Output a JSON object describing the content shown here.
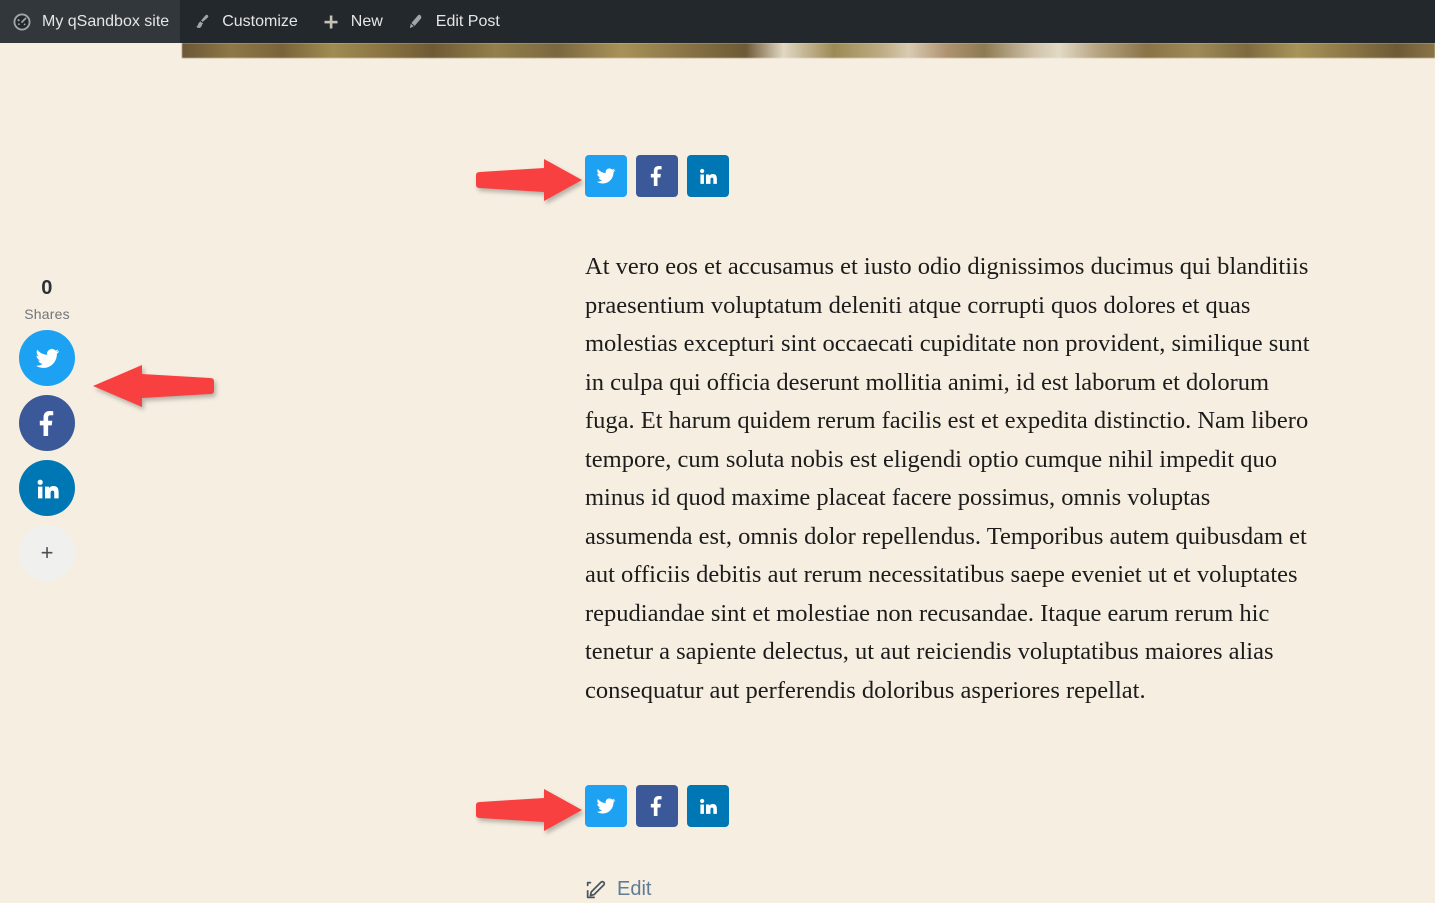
{
  "admin_bar": {
    "items": [
      {
        "icon": "wordpress-dashboard-icon",
        "label": "My qSandbox site"
      },
      {
        "icon": "paintbrush-icon",
        "label": "Customize"
      },
      {
        "icon": "plus-icon",
        "label": "New"
      },
      {
        "icon": "pencil-icon",
        "label": "Edit Post"
      }
    ],
    "background_color": "#23282d",
    "text_color": "#e5e5e5"
  },
  "page": {
    "background_color": "#f5eee1"
  },
  "float_share": {
    "count": "0",
    "count_label": "Shares",
    "buttons": [
      {
        "network": "twitter",
        "icon": "twitter-icon",
        "color": "#1da1f2"
      },
      {
        "network": "facebook",
        "icon": "facebook-icon",
        "color": "#3b5998"
      },
      {
        "network": "linkedin",
        "icon": "linkedin-icon",
        "color": "#0077b5"
      },
      {
        "network": "more",
        "icon": "plus-icon",
        "color": "#f0f0ee",
        "glyph": "+"
      }
    ]
  },
  "share_row_top": {
    "buttons": [
      {
        "network": "twitter",
        "icon": "twitter-icon",
        "color": "#1da1f2"
      },
      {
        "network": "facebook",
        "icon": "facebook-icon",
        "color": "#3b5998"
      },
      {
        "network": "linkedin",
        "icon": "linkedin-icon",
        "color": "#0077b5"
      }
    ]
  },
  "share_row_bottom": {
    "buttons": [
      {
        "network": "twitter",
        "icon": "twitter-icon",
        "color": "#1da1f2"
      },
      {
        "network": "facebook",
        "icon": "facebook-icon",
        "color": "#3b5998"
      },
      {
        "network": "linkedin",
        "icon": "linkedin-icon",
        "color": "#0077b5"
      }
    ]
  },
  "post": {
    "body": "At vero eos et accusamus et iusto odio dignissimos ducimus qui blanditiis praesentium voluptatum deleniti atque corrupti quos dolores et quas molestias excepturi sint occaecati cupiditate non provident, similique sunt in culpa qui officia deserunt mollitia animi, id est laborum et dolorum fuga. Et harum quidem rerum facilis est et expedita distinctio. Nam libero tempore, cum soluta nobis est eligendi optio cumque nihil impedit quo minus id quod maxime placeat facere possimus, omnis voluptas assumenda est, omnis dolor repellendus. Temporibus autem quibusdam et aut officiis debitis aut rerum necessitatibus saepe eveniet ut et voluptates repudiandae sint et molestiae non recusandae. Itaque earum rerum hic tenetur a sapiente delectus, ut aut reiciendis voluptatibus maiores alias consequatur aut perferendis doloribus asperiores repellat."
  },
  "edit": {
    "icon": "edit-pencil-icon",
    "label": "Edit"
  },
  "annotations": {
    "arrow_color": "#f94040",
    "arrows": [
      {
        "name": "arrow-pointing-to-top-share-row",
        "direction": "right"
      },
      {
        "name": "arrow-pointing-to-float-share-bar",
        "direction": "left"
      },
      {
        "name": "arrow-pointing-to-bottom-share-row",
        "direction": "right"
      }
    ]
  }
}
